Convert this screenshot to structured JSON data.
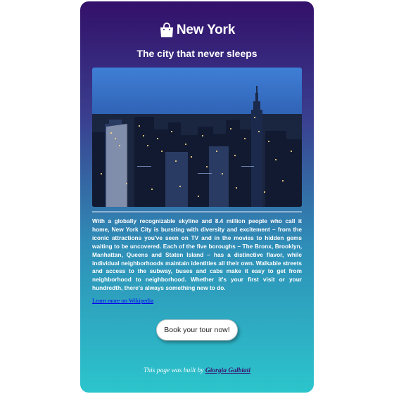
{
  "brand": {
    "title": "New York",
    "icon": "shopping-bag-icon"
  },
  "tagline": "The city that never sleeps",
  "hero": {
    "image": "new-york-skyline-night-photo"
  },
  "description": "With a globally recognizable skyline and 8.4 million people who call it home, New York City is bursting with diversity and excitement – from the iconic attractions you've seen on TV and in the movies to hidden gems waiting to be uncovered. Each of the five boroughs – The Bronx, Brooklyn, Manhattan, Queens and Staten Island – has a distinctive flavor, while individual neighborhoods maintain identities all their own. Walkable streets and access to the subway, buses and cabs make it easy to get from neighborhood to neighborhood. Whether it's your first visit or your hundredth, there's always something new to do.",
  "learn_more_label": "Learn more on Wikipedia",
  "cta_label": "Book your tour now!",
  "footer": {
    "prefix": "This page was built by",
    "author": "Giorgia Galbiati"
  },
  "colors": {
    "gradient_top": "#33106a",
    "gradient_bottom": "#2cc5cc",
    "footer_link": "#3a1070"
  }
}
